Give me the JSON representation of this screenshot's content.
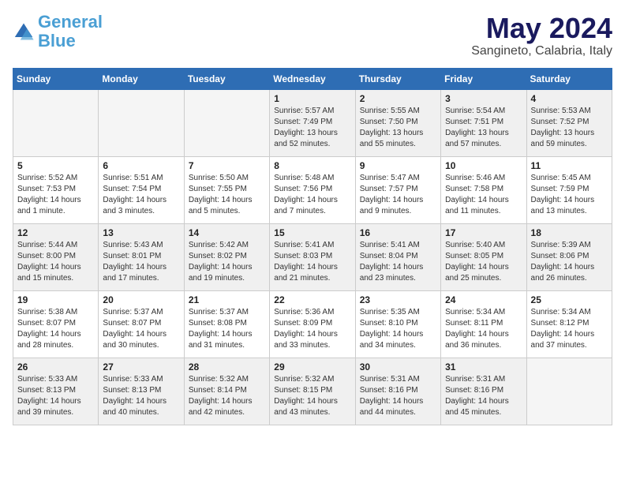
{
  "logo": {
    "line1": "General",
    "line2": "Blue"
  },
  "title": "May 2024",
  "location": "Sangineto, Calabria, Italy",
  "days_of_week": [
    "Sunday",
    "Monday",
    "Tuesday",
    "Wednesday",
    "Thursday",
    "Friday",
    "Saturday"
  ],
  "weeks": [
    [
      {
        "day": "",
        "info": ""
      },
      {
        "day": "",
        "info": ""
      },
      {
        "day": "",
        "info": ""
      },
      {
        "day": "1",
        "info": "Sunrise: 5:57 AM\nSunset: 7:49 PM\nDaylight: 13 hours\nand 52 minutes."
      },
      {
        "day": "2",
        "info": "Sunrise: 5:55 AM\nSunset: 7:50 PM\nDaylight: 13 hours\nand 55 minutes."
      },
      {
        "day": "3",
        "info": "Sunrise: 5:54 AM\nSunset: 7:51 PM\nDaylight: 13 hours\nand 57 minutes."
      },
      {
        "day": "4",
        "info": "Sunrise: 5:53 AM\nSunset: 7:52 PM\nDaylight: 13 hours\nand 59 minutes."
      }
    ],
    [
      {
        "day": "5",
        "info": "Sunrise: 5:52 AM\nSunset: 7:53 PM\nDaylight: 14 hours\nand 1 minute."
      },
      {
        "day": "6",
        "info": "Sunrise: 5:51 AM\nSunset: 7:54 PM\nDaylight: 14 hours\nand 3 minutes."
      },
      {
        "day": "7",
        "info": "Sunrise: 5:50 AM\nSunset: 7:55 PM\nDaylight: 14 hours\nand 5 minutes."
      },
      {
        "day": "8",
        "info": "Sunrise: 5:48 AM\nSunset: 7:56 PM\nDaylight: 14 hours\nand 7 minutes."
      },
      {
        "day": "9",
        "info": "Sunrise: 5:47 AM\nSunset: 7:57 PM\nDaylight: 14 hours\nand 9 minutes."
      },
      {
        "day": "10",
        "info": "Sunrise: 5:46 AM\nSunset: 7:58 PM\nDaylight: 14 hours\nand 11 minutes."
      },
      {
        "day": "11",
        "info": "Sunrise: 5:45 AM\nSunset: 7:59 PM\nDaylight: 14 hours\nand 13 minutes."
      }
    ],
    [
      {
        "day": "12",
        "info": "Sunrise: 5:44 AM\nSunset: 8:00 PM\nDaylight: 14 hours\nand 15 minutes."
      },
      {
        "day": "13",
        "info": "Sunrise: 5:43 AM\nSunset: 8:01 PM\nDaylight: 14 hours\nand 17 minutes."
      },
      {
        "day": "14",
        "info": "Sunrise: 5:42 AM\nSunset: 8:02 PM\nDaylight: 14 hours\nand 19 minutes."
      },
      {
        "day": "15",
        "info": "Sunrise: 5:41 AM\nSunset: 8:03 PM\nDaylight: 14 hours\nand 21 minutes."
      },
      {
        "day": "16",
        "info": "Sunrise: 5:41 AM\nSunset: 8:04 PM\nDaylight: 14 hours\nand 23 minutes."
      },
      {
        "day": "17",
        "info": "Sunrise: 5:40 AM\nSunset: 8:05 PM\nDaylight: 14 hours\nand 25 minutes."
      },
      {
        "day": "18",
        "info": "Sunrise: 5:39 AM\nSunset: 8:06 PM\nDaylight: 14 hours\nand 26 minutes."
      }
    ],
    [
      {
        "day": "19",
        "info": "Sunrise: 5:38 AM\nSunset: 8:07 PM\nDaylight: 14 hours\nand 28 minutes."
      },
      {
        "day": "20",
        "info": "Sunrise: 5:37 AM\nSunset: 8:07 PM\nDaylight: 14 hours\nand 30 minutes."
      },
      {
        "day": "21",
        "info": "Sunrise: 5:37 AM\nSunset: 8:08 PM\nDaylight: 14 hours\nand 31 minutes."
      },
      {
        "day": "22",
        "info": "Sunrise: 5:36 AM\nSunset: 8:09 PM\nDaylight: 14 hours\nand 33 minutes."
      },
      {
        "day": "23",
        "info": "Sunrise: 5:35 AM\nSunset: 8:10 PM\nDaylight: 14 hours\nand 34 minutes."
      },
      {
        "day": "24",
        "info": "Sunrise: 5:34 AM\nSunset: 8:11 PM\nDaylight: 14 hours\nand 36 minutes."
      },
      {
        "day": "25",
        "info": "Sunrise: 5:34 AM\nSunset: 8:12 PM\nDaylight: 14 hours\nand 37 minutes."
      }
    ],
    [
      {
        "day": "26",
        "info": "Sunrise: 5:33 AM\nSunset: 8:13 PM\nDaylight: 14 hours\nand 39 minutes."
      },
      {
        "day": "27",
        "info": "Sunrise: 5:33 AM\nSunset: 8:13 PM\nDaylight: 14 hours\nand 40 minutes."
      },
      {
        "day": "28",
        "info": "Sunrise: 5:32 AM\nSunset: 8:14 PM\nDaylight: 14 hours\nand 42 minutes."
      },
      {
        "day": "29",
        "info": "Sunrise: 5:32 AM\nSunset: 8:15 PM\nDaylight: 14 hours\nand 43 minutes."
      },
      {
        "day": "30",
        "info": "Sunrise: 5:31 AM\nSunset: 8:16 PM\nDaylight: 14 hours\nand 44 minutes."
      },
      {
        "day": "31",
        "info": "Sunrise: 5:31 AM\nSunset: 8:16 PM\nDaylight: 14 hours\nand 45 minutes."
      },
      {
        "day": "",
        "info": ""
      }
    ]
  ]
}
